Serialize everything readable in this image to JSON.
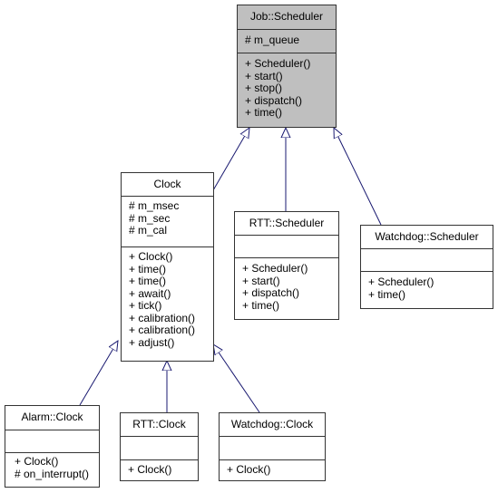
{
  "classes": {
    "job_scheduler": {
      "name": "Job::Scheduler",
      "attributes": [
        "# m_queue"
      ],
      "methods": [
        "+ Scheduler()",
        "+ start()",
        "+ stop()",
        "+ dispatch()",
        "+ time()"
      ],
      "fill": "#bfbfbf"
    },
    "clock": {
      "name": "Clock",
      "attributes": [
        "# m_msec",
        "# m_sec",
        "# m_cal"
      ],
      "methods": [
        "+ Clock()",
        "+ time()",
        "+ time()",
        "+ await()",
        "+ tick()",
        "+ calibration()",
        "+ calibration()",
        "+ adjust()"
      ]
    },
    "rtt_scheduler": {
      "name": "RTT::Scheduler",
      "attributes": [],
      "methods": [
        "+ Scheduler()",
        "+ start()",
        "+ dispatch()",
        "+ time()"
      ]
    },
    "watchdog_scheduler": {
      "name": "Watchdog::Scheduler",
      "attributes": [],
      "methods": [
        "+ Scheduler()",
        "+ time()"
      ]
    },
    "alarm_clock": {
      "name": "Alarm::Clock",
      "attributes": [],
      "methods": [
        "+ Clock()",
        "# on_interrupt()"
      ]
    },
    "rtt_clock": {
      "name": "RTT::Clock",
      "attributes": [],
      "methods": [
        "+ Clock()"
      ]
    },
    "watchdog_clock": {
      "name": "Watchdog::Clock",
      "attributes": [],
      "methods": [
        "+ Clock()"
      ]
    }
  },
  "inheritance": [
    {
      "from": "Clock",
      "to": "Job::Scheduler"
    },
    {
      "from": "RTT::Scheduler",
      "to": "Job::Scheduler"
    },
    {
      "from": "Watchdog::Scheduler",
      "to": "Job::Scheduler"
    },
    {
      "from": "Alarm::Clock",
      "to": "Clock"
    },
    {
      "from": "RTT::Clock",
      "to": "Clock"
    },
    {
      "from": "Watchdog::Clock",
      "to": "Clock"
    }
  ],
  "edge_color": "#191970"
}
